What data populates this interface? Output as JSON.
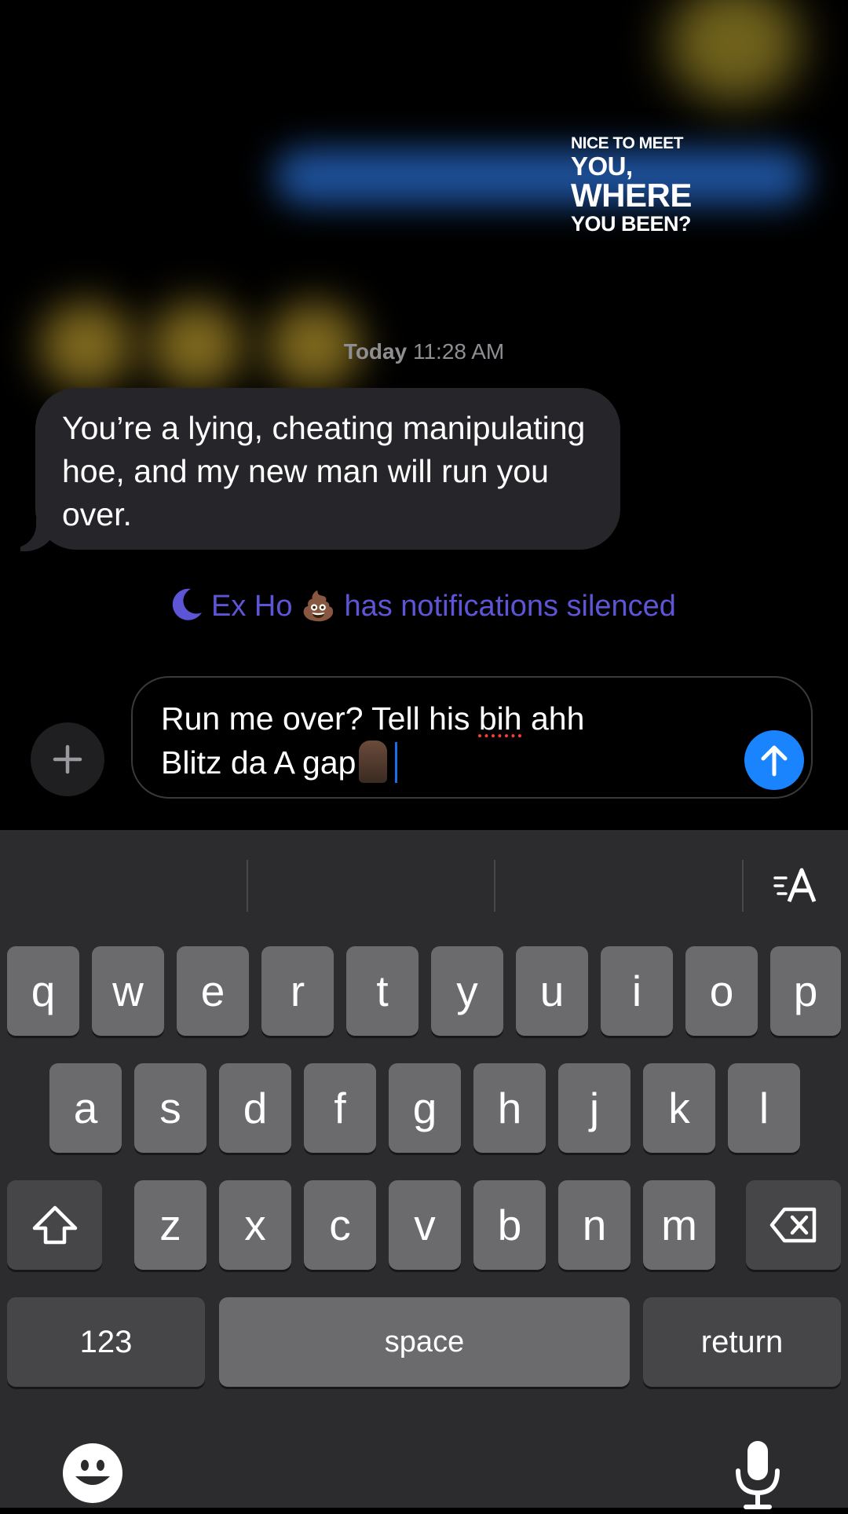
{
  "sticker": {
    "line1": "NICE TO MEET",
    "line2": "YOU,",
    "line3": "WHERE",
    "line4": "YOU BEEN?"
  },
  "timestamp": {
    "day": "Today",
    "time": "11:28 AM"
  },
  "incoming_message": "You’re a lying, cheating manipulating hoe, and my new man will run you over.",
  "status": {
    "name": "Ex Ho",
    "emoji": "💩",
    "text": "has notifications silenced",
    "color": "#5e55d6"
  },
  "composer": {
    "text_before": "Run me over? Tell his ",
    "misspelled": "bih",
    "text_after_line1": " ahh",
    "line2": "Blitz da A gap",
    "send_color": "#1a84ff"
  },
  "keyboard": {
    "row1": [
      "q",
      "w",
      "e",
      "r",
      "t",
      "y",
      "u",
      "i",
      "o",
      "p"
    ],
    "row2": [
      "a",
      "s",
      "d",
      "f",
      "g",
      "h",
      "j",
      "k",
      "l"
    ],
    "row3": [
      "z",
      "x",
      "c",
      "v",
      "b",
      "n",
      "m"
    ],
    "numbers_label": "123",
    "space_label": "space",
    "return_label": "return"
  }
}
